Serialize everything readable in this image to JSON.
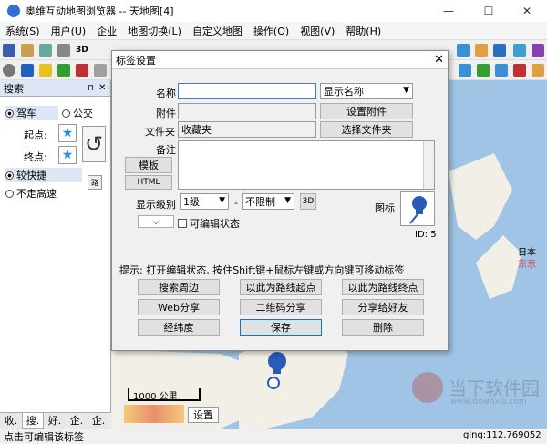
{
  "window": {
    "title": "奥维互动地图浏览器 -- 天地图[4]"
  },
  "menu": [
    "系统(S)",
    "用户(U)",
    "企业",
    "地图切换(L)",
    "自定义地图",
    "操作(O)",
    "视图(V)",
    "帮助(H)"
  ],
  "toolbar": {
    "btn_3d": "3D"
  },
  "left": {
    "title": "搜索",
    "mode_car": "驾车",
    "mode_bus": "公交",
    "start_label": "起点:",
    "end_label": "终点:",
    "opt_fast": "较快捷",
    "opt_nohw": "不走高速",
    "road_btn": "路",
    "tabs": [
      "收.",
      "搜.",
      "好.",
      "企.",
      "企."
    ]
  },
  "dialog": {
    "title": "标签设置",
    "name_label": "名称",
    "name_value": "",
    "show_name": "显示名称",
    "attach_label": "附件",
    "set_attach": "设置附件",
    "folder_label": "文件夹",
    "folder_value": "收藏夹",
    "choose_folder": "选择文件夹",
    "note_label": "备注",
    "template_btn": "模板",
    "html_btn": "HTML",
    "level_label": "显示级别",
    "level_from": "1级",
    "level_dash": "-",
    "level_to": "不限制",
    "btn_3d": "3D",
    "icon_label": "图标",
    "id_text": "ID: 5",
    "editable_label": "可编辑状态",
    "hint": "提示: 打开编辑状态, 按住Shift键+鼠标左键或方向键可移动标签",
    "buttons": [
      "搜索周边",
      "以此为路线起点",
      "以此为路线终点",
      "Web分享",
      "二维码分享",
      "分享给好友",
      "经纬度",
      "保存",
      "删除"
    ]
  },
  "map": {
    "japan": "日本",
    "tokyo": "东京",
    "scale": "1000 公里",
    "settings_btn": "设置"
  },
  "status": {
    "left_text": "点击可编辑该标签",
    "right_text": "glng:112.769052"
  },
  "watermark": {
    "main": "当下软件园",
    "sub": "www.downxia.com"
  }
}
